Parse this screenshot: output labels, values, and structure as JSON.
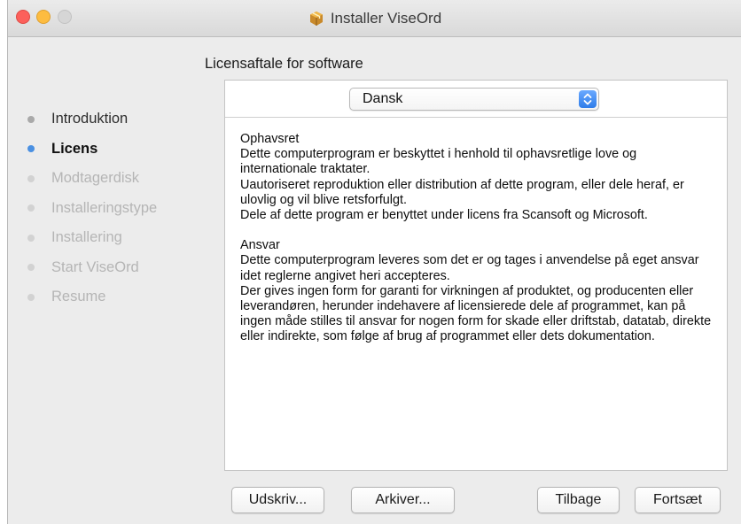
{
  "window": {
    "title": "Installer ViseOrd",
    "title_icon": "package-icon"
  },
  "sidebar": {
    "steps": [
      {
        "label": "Introduktion",
        "state": "done"
      },
      {
        "label": "Licens",
        "state": "current"
      },
      {
        "label": "Modtagerdisk",
        "state": "pending"
      },
      {
        "label": "Installeringstype",
        "state": "pending"
      },
      {
        "label": "Installering",
        "state": "pending"
      },
      {
        "label": "Start ViseOrd",
        "state": "pending"
      },
      {
        "label": "Resume",
        "state": "pending"
      }
    ]
  },
  "main": {
    "title": "Licensaftale for software",
    "language_select": {
      "selected": "Dansk"
    },
    "license": {
      "section1_heading": "Ophavsret",
      "section1_p1": "Dette computerprogram er beskyttet i henhold til ophavsretlige love og internationale traktater.",
      "section1_p2": "Uautoriseret reproduktion eller distribution af dette program, eller dele heraf, er ulovlig og vil blive retsforfulgt.",
      "section1_p3": "Dele af dette program er benyttet under licens fra Scansoft og Microsoft.",
      "section2_heading": "Ansvar",
      "section2_p1": "Dette computerprogram leveres som det er og tages i anvendelse på eget ansvar idet reglerne angivet heri accepteres.",
      "section2_p2": "Der gives ingen form for garanti for virkningen af produktet, og producenten eller leverandøren, herunder indehavere af licensierede dele af programmet, kan på ingen måde stilles til ansvar for nogen form for skade eller driftstab, datatab, direkte eller indirekte, som følge af brug af programmet eller dets dokumentation."
    }
  },
  "buttons": {
    "print": "Udskriv...",
    "save": "Arkiver...",
    "back": "Tilbage",
    "continue": "Fortsæt"
  },
  "colors": {
    "accent": "#4a90e2",
    "close": "#fc605b",
    "minimize": "#fdbc40",
    "zoom_disabled": "#d6d6d6"
  }
}
